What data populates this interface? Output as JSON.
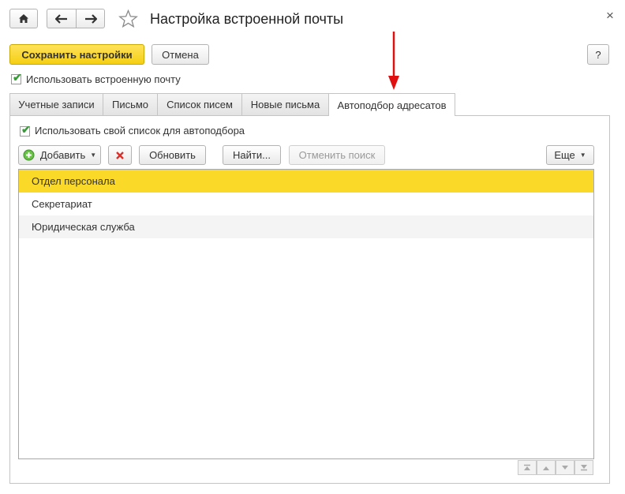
{
  "window": {
    "title": "Настройка встроенной почты",
    "close_glyph": "×"
  },
  "toolbar": {
    "save_label": "Сохранить настройки",
    "cancel_label": "Отмена",
    "help_label": "?"
  },
  "use_builtin_mail": {
    "label": "Использовать встроенную почту",
    "checked": true
  },
  "tabs": [
    {
      "label": "Учетные записи",
      "active": false
    },
    {
      "label": "Письмо",
      "active": false
    },
    {
      "label": "Список писем",
      "active": false
    },
    {
      "label": "Новые письма",
      "active": false
    },
    {
      "label": "Автоподбор адресатов",
      "active": true
    }
  ],
  "autocomplete": {
    "use_own_list_label": "Использовать свой список для автоподбора",
    "use_own_list_checked": true,
    "buttons": {
      "add": "Добавить",
      "refresh": "Обновить",
      "find": "Найти...",
      "cancel_search": "Отменить поиск",
      "more": "Еще"
    },
    "rows": [
      {
        "label": "Отдел персонала",
        "selected": true
      },
      {
        "label": "Секретариат",
        "selected": false
      },
      {
        "label": "Юридическая служба",
        "selected": false
      }
    ]
  },
  "colors": {
    "accent_yellow": "#fbd929",
    "annotation_arrow": "#e01010",
    "checkmark_green": "#3a9a3a"
  }
}
